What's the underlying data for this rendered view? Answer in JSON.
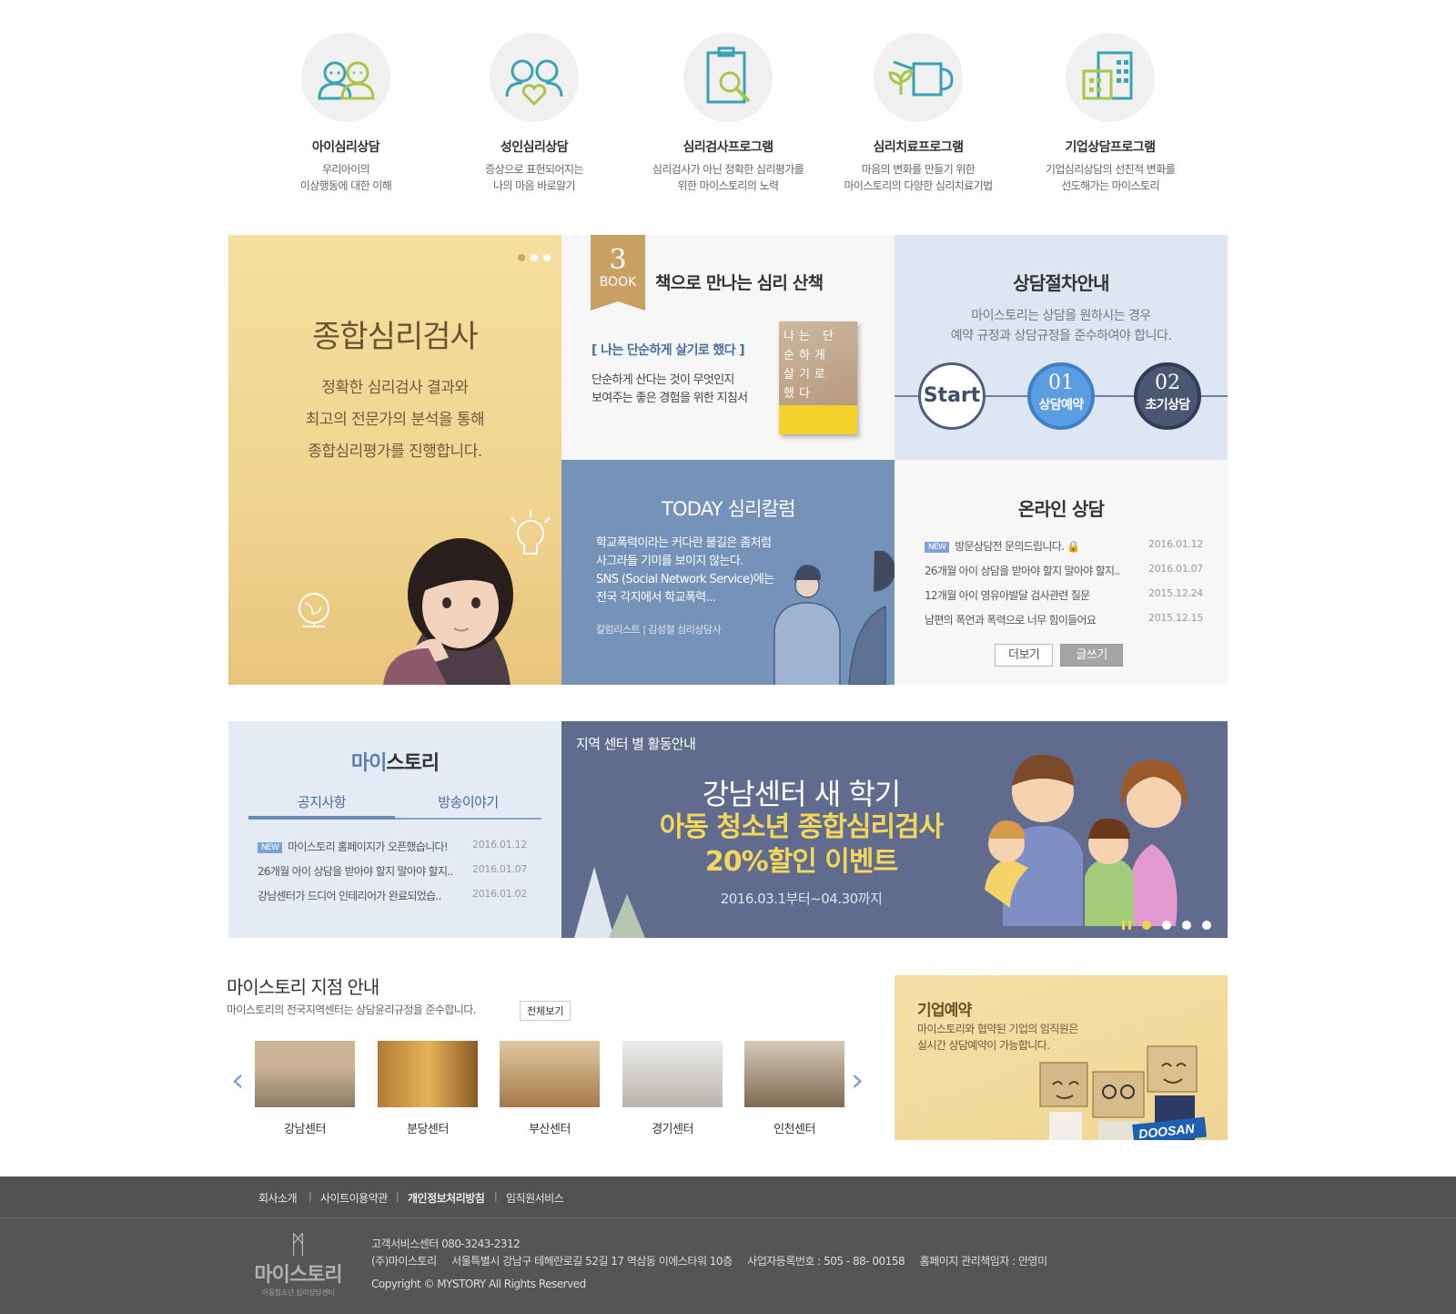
{
  "services": [
    {
      "title": "아이심리상담",
      "desc1": "우리아이의",
      "desc2": "이상행동에 대한 이해",
      "icon": "two-children-icon"
    },
    {
      "title": "성인심리상담",
      "desc1": "증상으로 표현되어지는",
      "desc2": "나의 마음 바로알기",
      "icon": "couple-heart-icon"
    },
    {
      "title": "심리검사프로그램",
      "desc1": "심리검사가 아닌 정확한 심리평가를",
      "desc2": "위한 마이스토리의 노력",
      "icon": "clipboard-magnifier-icon"
    },
    {
      "title": "심리치료프로그램",
      "desc1": "마음의 변화를 만들기 위한",
      "desc2": "마이스토리의 다양한 심리치료기법",
      "icon": "watering-can-plant-icon"
    },
    {
      "title": "기업상담프로그램",
      "desc1": "기업심리상담의 선진적 변화를",
      "desc2": "선도해가는 마이스토리",
      "icon": "office-building-icon"
    }
  ],
  "promo": {
    "title": "종합심리검사",
    "line1": "정확한 심리검사 결과와",
    "line2": "최고의 전문가의 분석을 통해",
    "line3": "종합심리평가를 진행합니다."
  },
  "book": {
    "ribbon_num": "3",
    "ribbon_label": "BOOK",
    "heading": "책으로 만나는 심리 산책",
    "book_title": "[ 나는 단순하게 살기로 했다 ]",
    "desc1": "단순하게 산다는 것이 무엇인지",
    "desc2": "보여주는 좋은 경험을 위한 지침서",
    "cover_text": "나는 단순하게 살기로 했다"
  },
  "procedure": {
    "heading": "상담절차안내",
    "desc1": "마이스토리는 상담을 원하시는 경우",
    "desc2": "예약 규정과 상담규정을 준수하여야 합니다.",
    "start": "Start",
    "step1_num": "01",
    "step1_label": "상담예약",
    "step2_num": "02",
    "step2_label": "초기상담"
  },
  "column": {
    "heading": "TODAY 심리칼럼",
    "line1": "학교폭력이라는 커다란 불길은 좀처럼",
    "line2": "사그라들 기미를 보이지 않는다.",
    "line3": "SNS (Social Network Service)에는",
    "line4": "전국 각지에서 학교폭력...",
    "author": "칼럼리스트  |  김성철 심리상담사"
  },
  "online": {
    "heading": "온라인 상담",
    "new_badge": "NEW",
    "rows": [
      {
        "title": "방문상담전 문의드립니다. 🔒",
        "date": "2016.01.12"
      },
      {
        "title": "26개월 아이 상담을 받아야 할지 말아야 할지..",
        "date": "2016.01.07"
      },
      {
        "title": "12개월 아이 영유아발달 검사관련 질문",
        "date": "2015.12.24"
      },
      {
        "title": "남편의 폭언과 폭력으로 너무 힘이들어요",
        "date": "2015.12.15"
      }
    ],
    "more": "더보기",
    "write": "글쓰기"
  },
  "mystory": {
    "heading_a": "마이",
    "heading_b": "스토리",
    "tab1": "공지사항",
    "tab2": "방송이야기",
    "new_badge": "NEW",
    "rows": [
      {
        "title": "마이스토리 홈페이지가 오픈했습니다!",
        "date": "2016.01.12"
      },
      {
        "title": "26개월 아이 상담을 받아야 할지 말아야 할지..",
        "date": "2016.01.07"
      },
      {
        "title": "강남센터가 드디어 인테리어가 완료되었습..",
        "date": "2016.01.02"
      }
    ]
  },
  "event": {
    "label": "지역 센터 별 활동안내",
    "title": "강남센터 새 학기",
    "line1": "아동 청소년 종합심리검사",
    "line2": "20%할인 이벤트",
    "period": "2016.03.1부터~04.30까지"
  },
  "branches": {
    "heading": "마이스토리 지점 안내",
    "desc": "마이스토리의 전국지역센터는 상담윤리규정을 준수합니다.",
    "all": "전체보기",
    "items": [
      "강남센터",
      "분당센터",
      "부산센터",
      "경기센터",
      "인천센터"
    ]
  },
  "corp": {
    "heading": "기업예약",
    "line1": "마이스토리와 협약된 기업의 임직원은",
    "line2": "실시간 상담예약이 가능합니다.",
    "brand": "DOOSAN"
  },
  "footer": {
    "menu": [
      "회사소개",
      "사이트이용약관",
      "개인정보처리방침",
      "임직원서비스"
    ],
    "logo_name": "마이스토리",
    "logo_sub": "아동청소년 심리상담센터",
    "phone": "고객서비스센터 080-3243-2312",
    "address": "(주)마이스토리     서울특별시 강남구 테헤란로길 52길 17 역삼동 이에스타워 10층     사업자등록번호 : 505 - 88- 00158     홈페이지 관리책임자 : 안영미",
    "copyright": "Copyright © MYSTORY All Rights Reserved"
  },
  "colors": {
    "gold": "#f0d48e",
    "blue_tile": "#7592b8",
    "event": "#606b8e",
    "proc": "#dde6f2",
    "footer": "#555555"
  }
}
